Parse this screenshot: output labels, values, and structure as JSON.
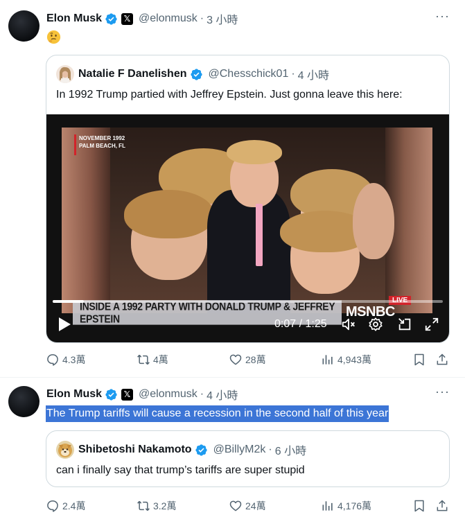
{
  "post1": {
    "author": "Elon Musk",
    "handle": "@elonmusk",
    "separator": "·",
    "time": "3 小時",
    "emoji": "thinking-face",
    "quote": {
      "author": "Natalie F Danelishen",
      "handle": "@Chesschick01",
      "separator": "·",
      "time": "4 小時",
      "text": "In 1992 Trump partied with Jeffrey Epstein. Just gonna leave this here:",
      "video": {
        "date_overlay_line1": "NOVEMBER 1992",
        "date_overlay_line2": "PALM BEACH, FL",
        "chyron": "INSIDE A 1992 PARTY WITH DONALD TRUMP & JEFFREY EPSTEIN",
        "live_label": "LIVE",
        "network": "MSNBC",
        "time_display": "0:07 / 1:25",
        "progress": 0.08
      }
    },
    "actions": {
      "replies": "4.3萬",
      "reposts": "4萬",
      "likes": "28萬",
      "views": "4,943萬"
    }
  },
  "post2": {
    "author": "Elon Musk",
    "handle": "@elonmusk",
    "separator": "·",
    "time": "4 小時",
    "text": "The Trump tariffs will cause a recession in the second half of this year",
    "quote": {
      "author": "Shibetoshi Nakamoto",
      "handle": "@BillyM2k",
      "separator": "·",
      "time": "6 小時",
      "text": "can i finally say that trump’s tariffs are super stupid"
    },
    "actions": {
      "replies": "2.4萬",
      "reposts": "3.2萬",
      "likes": "24萬",
      "views": "4,176萬"
    }
  },
  "more_label": "···",
  "x_badge": "𝕏",
  "colors": {
    "verified": "#1d9bf0",
    "text_secondary": "#536471",
    "selection": "#3c75d6",
    "live": "#d2232a"
  }
}
